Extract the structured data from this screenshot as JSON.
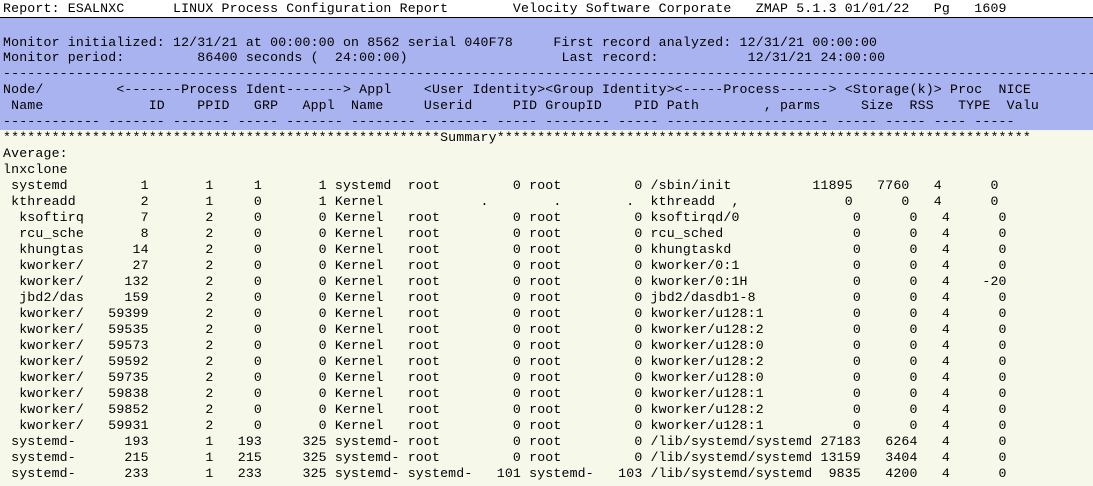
{
  "report": {
    "title_line": "Report: ESALNXC      LINUX Process Configuration Report        Velocity Software Corporate   ZMAP 5.1.3 01/01/22   Pg   1609"
  },
  "monitor": {
    "line1": "Monitor initialized: 12/31/21 at 00:00:00 on 8562 serial 040F78     First record analyzed: 12/31/21 00:00:00",
    "line2": "Monitor period:         86400 seconds (  24:00:00)                   Last record:           12/31/21 24:00:00"
  },
  "columns": {
    "rule_top": "----------------------------------------------------------------------------------------------------------------------------------------------------",
    "header1": "Node/         <-------Process Ident-------> Appl    <User Identity><Group Identity><-----Process------> <Storage(k)> Proc  NICE",
    "header2": " Name             ID    PPID   GRP   Appl  Name     Userid     PID GroupID    PID Path        , parms     Size  RSS   TYPE  Valu",
    "rule_bottom": "------------ ------- ------- ----- ------- -------- -------- ----- -------- ----- -------------------- ----- ----- ---- -----"
  },
  "summary": {
    "banner": "******************************************************Summary******************************************************************",
    "average_label": "Average:",
    "node_label": "lnxclone"
  },
  "rows": [
    " systemd         1       1     1       1 systemd  root         0 root         0 /sbin/init          11895   7760   4      0",
    " kthreadd        2       1     0       1 Kernel            .        .        .  kthreadd  ,             0      0   4      0",
    "  ksoftirq       7       2     0       0 Kernel   root         0 root         0 ksoftirqd/0              0      0   4      0",
    "  rcu_sche       8       2     0       0 Kernel   root         0 root         0 rcu_sched                0      0   4      0",
    "  khungtas      14       2     0       0 Kernel   root         0 root         0 khungtaskd               0      0   4      0",
    "  kworker/      27       2     0       0 Kernel   root         0 root         0 kworker/0:1              0      0   4      0",
    "  kworker/     132       2     0       0 Kernel   root         0 root         0 kworker/0:1H             0      0   4    -20",
    "  jbd2/das     159       2     0       0 Kernel   root         0 root         0 jbd2/dasdb1-8            0      0   4      0",
    "  kworker/   59399       2     0       0 Kernel   root         0 root         0 kworker/u128:1           0      0   4      0",
    "  kworker/   59535       2     0       0 Kernel   root         0 root         0 kworker/u128:2           0      0   4      0",
    "  kworker/   59573       2     0       0 Kernel   root         0 root         0 kworker/u128:0           0      0   4      0",
    "  kworker/   59592       2     0       0 Kernel   root         0 root         0 kworker/u128:2           0      0   4      0",
    "  kworker/   59735       2     0       0 Kernel   root         0 root         0 kworker/u128:0           0      0   4      0",
    "  kworker/   59838       2     0       0 Kernel   root         0 root         0 kworker/u128:1           0      0   4      0",
    "  kworker/   59852       2     0       0 Kernel   root         0 root         0 kworker/u128:2           0      0   4      0",
    "  kworker/   59931       2     0       0 Kernel   root         0 root         0 kworker/u128:1           0      0   4      0",
    " systemd-      193       1   193     325 systemd- root         0 root         0 /lib/systemd/systemd 27183   6264   4      0",
    " systemd-      215       1   215     325 systemd- root         0 root         0 /lib/systemd/systemd 13159   3404   4      0",
    " systemd-      233       1   233     325 systemd- systemd-   101 systemd-   103 /lib/systemd/systemd  9835   4200   4      0"
  ]
}
